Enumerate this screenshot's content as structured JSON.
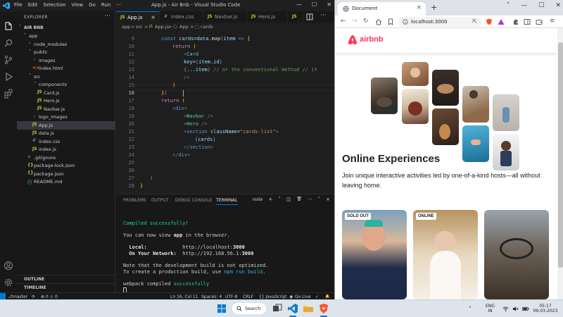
{
  "vscode": {
    "title": "App.js - Air Bnb - Visual Studio Code",
    "menu": [
      "File",
      "Edit",
      "Selection",
      "View",
      "Go",
      "Run",
      "···"
    ],
    "explorer_header": "EXPLORER",
    "project": "AIR BNB",
    "tree": [
      {
        "label": "app",
        "indent": 1,
        "type": "folder-open",
        "selected": false
      },
      {
        "label": "node_modules",
        "indent": 2,
        "type": "folder",
        "selected": false
      },
      {
        "label": "public",
        "indent": 2,
        "type": "folder-open",
        "selected": false
      },
      {
        "label": "images",
        "indent": 3,
        "type": "folder",
        "selected": false
      },
      {
        "label": "index.html",
        "indent": 3,
        "type": "html",
        "selected": false
      },
      {
        "label": "src",
        "indent": 2,
        "type": "folder-open",
        "selected": false
      },
      {
        "label": "components",
        "indent": 3,
        "type": "folder-open",
        "selected": false
      },
      {
        "label": "Card.js",
        "indent": 4,
        "type": "js",
        "selected": false
      },
      {
        "label": "Hero.js",
        "indent": 4,
        "type": "js",
        "selected": false
      },
      {
        "label": "Navbar.js",
        "indent": 4,
        "type": "js",
        "selected": false
      },
      {
        "label": "logo_images",
        "indent": 3,
        "type": "folder",
        "selected": false
      },
      {
        "label": "App.js",
        "indent": 3,
        "type": "js",
        "selected": true
      },
      {
        "label": "data.js",
        "indent": 3,
        "type": "js",
        "selected": false
      },
      {
        "label": "index.css",
        "indent": 3,
        "type": "css",
        "selected": false
      },
      {
        "label": "index.js",
        "indent": 3,
        "type": "js",
        "selected": false
      },
      {
        "label": ".gitignore",
        "indent": 2,
        "type": "git",
        "selected": false
      },
      {
        "label": "package-lock.json",
        "indent": 2,
        "type": "json",
        "selected": false
      },
      {
        "label": "package.json",
        "indent": 2,
        "type": "json",
        "selected": false
      },
      {
        "label": "README.md",
        "indent": 2,
        "type": "md",
        "selected": false
      }
    ],
    "sections": [
      "OUTLINE",
      "TIMELINE"
    ],
    "tabs": [
      {
        "icon": "JS",
        "label": "App.js",
        "active": true,
        "close": "×"
      },
      {
        "icon": "#",
        "label": "index.css",
        "active": false,
        "close": ""
      },
      {
        "icon": "JS",
        "label": "Navbar.js",
        "active": false,
        "close": ""
      },
      {
        "icon": "JS",
        "label": "Hero.js",
        "active": false,
        "close": ""
      },
      {
        "icon": "JS",
        "label": "J",
        "active": false,
        "close": ""
      }
    ],
    "breadcrumb": [
      "app",
      ">",
      "src",
      ">",
      "App.js",
      ">",
      "App",
      ">",
      "cards"
    ],
    "line_numbers": [
      "9",
      "10",
      "11",
      "12",
      "13",
      "14",
      "15",
      "16",
      "17",
      "18",
      "19",
      "20",
      "21",
      "22",
      "23",
      "24",
      "25",
      "26",
      "27",
      "28"
    ],
    "current_line": "16",
    "code": {
      "l9": [
        "const",
        " ",
        "cards",
        "=",
        "data",
        ".",
        "map",
        "(",
        "item",
        " => ",
        "{"
      ],
      "l10": [
        "return",
        " ("
      ],
      "l11": [
        "<",
        "Card"
      ],
      "l12": [
        "key",
        "=",
        "{",
        "item.id",
        "}"
      ],
      "l13": [
        "{",
        "...item",
        "}",
        " // or the conventional method // it"
      ],
      "l14": [
        "/>"
      ],
      "l15": [
        ")"
      ],
      "l16": [
        "}",
        ")"
      ],
      "l17": [
        "return",
        " ("
      ],
      "l18": [
        "<",
        "div",
        ">"
      ],
      "l19": [
        "<",
        "Navbar",
        " />"
      ],
      "l20": [
        "<",
        "Hero",
        " />"
      ],
      "l21": [
        "<",
        "section",
        " ",
        "className",
        "=",
        "\"cards-list\"",
        ">"
      ],
      "l22": [
        "{",
        "cards",
        "}"
      ],
      "l23": [
        "</",
        "section",
        ">"
      ],
      "l24": [
        "</",
        "div",
        ">"
      ],
      "l27": [
        ")"
      ],
      "l28": [
        "}"
      ]
    },
    "panel_tabs": [
      "PROBLEMS",
      "OUTPUT",
      "DEBUG CONSOLE",
      "TERMINAL"
    ],
    "terminal_tools": [
      "node",
      "+",
      "˅",
      "◫",
      "🗑",
      "···",
      "˄",
      "×"
    ],
    "terminal": {
      "compiled": "Compiled successfully!",
      "view_pre": "You can now view ",
      "view_app": "app",
      "view_post": " in the browser.",
      "local_label": "  Local:",
      "local_pre": "            http://localhost:",
      "local_port": "3000",
      "network_label": "  On Your Network:",
      "network_pre": "  http://192.168.56.1:",
      "network_port": "3000",
      "note1": "Note that the development build is not optimized.",
      "note2_pre": "To create a production build, use ",
      "note2_cmd": "npm run build",
      "note2_post": ".",
      "wp_pre": "webpack compiled ",
      "wp_ok": "successfully"
    },
    "status": {
      "branch": "master",
      "sync": "⟳",
      "errors": "⊗ 0 ⚠ 0",
      "position": "Ln 16, Col 11",
      "spaces": "Spaces: 4",
      "encoding": "UTF-8",
      "eol": "CRLF",
      "language": "{} JavaScript",
      "golive": "Go Live",
      "check": "✓",
      "bell": "🔔"
    }
  },
  "browser": {
    "tab_title": "Document",
    "url": "localhost:3000",
    "brand_color": "#ff385c",
    "brand": "airbnb",
    "heading": "Online Experiences",
    "description": "Join unique interactive activities led by one-of-a-kind hosts—all without leaving home.",
    "cards": [
      {
        "badge": "SOLD OUT"
      },
      {
        "badge": "ONLINE"
      },
      {
        "badge": ""
      }
    ]
  },
  "taskbar": {
    "search": "Search",
    "lang1": "ENG",
    "lang2": "IN",
    "time": "05:17",
    "date": "09-03-2023",
    "tray_up": "˄"
  }
}
